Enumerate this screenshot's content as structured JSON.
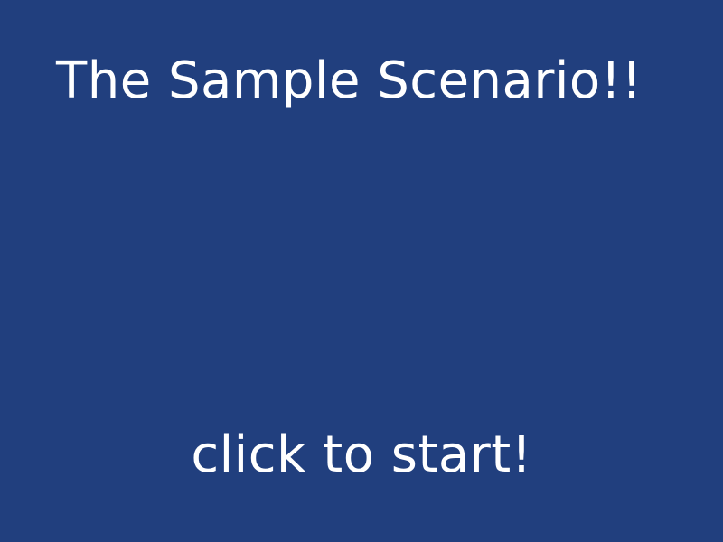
{
  "screen": {
    "background_color": "#213f7e",
    "text_color": "#ffffff",
    "title": "The Sample Scenario!!",
    "start_prompt": "click to start!"
  }
}
